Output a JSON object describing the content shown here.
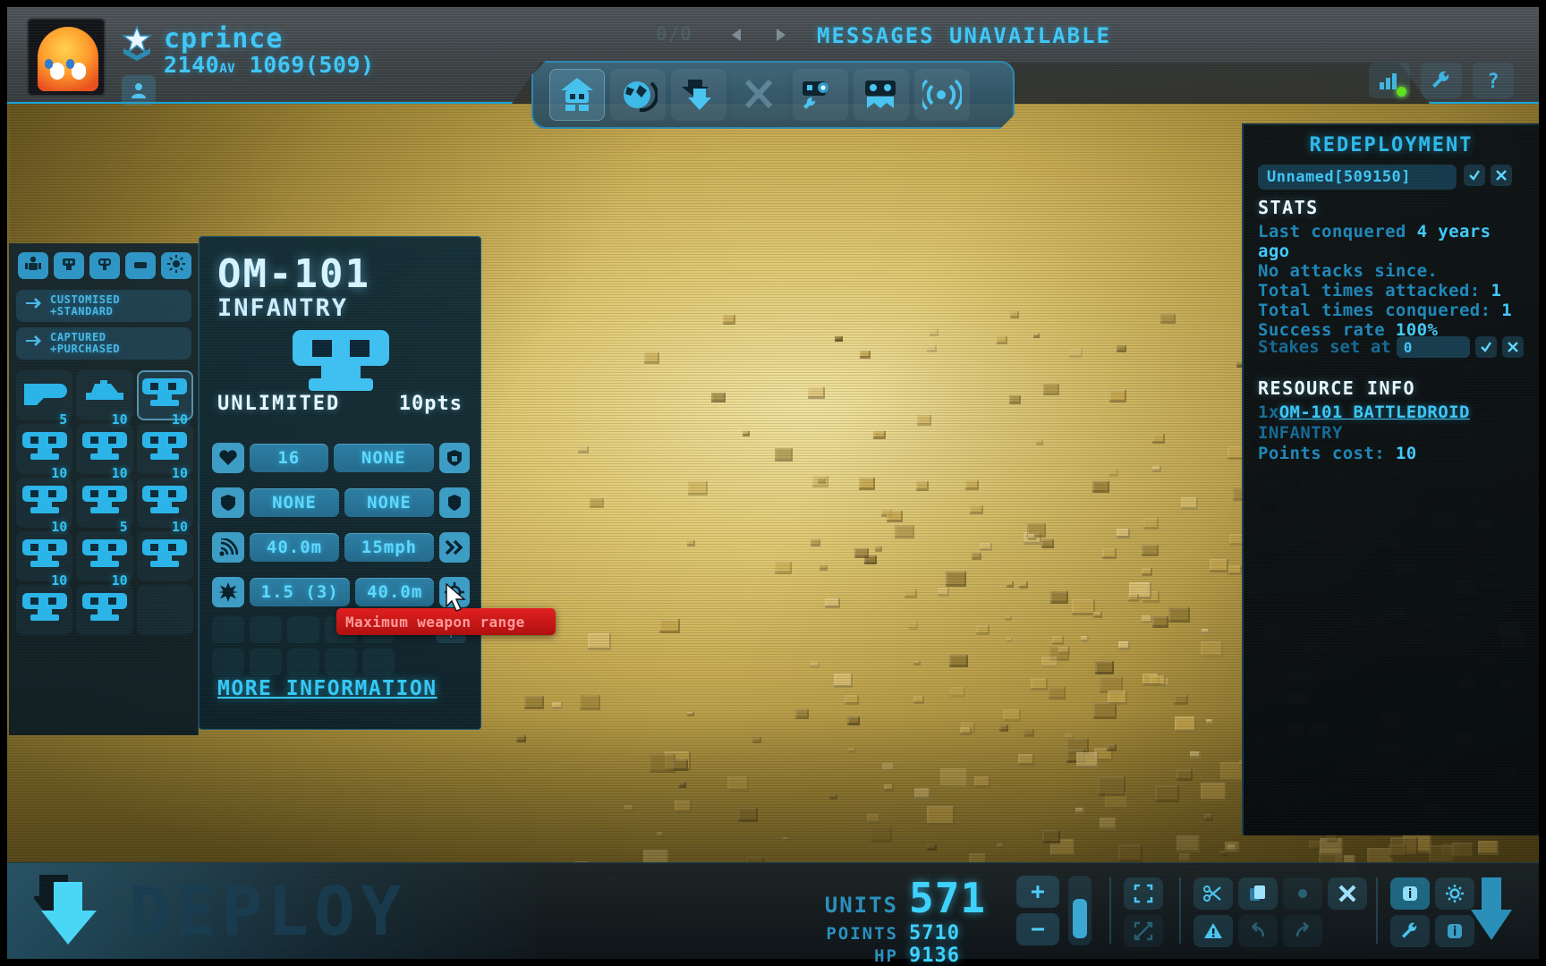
{
  "header": {
    "player_name": "cprince",
    "player_stats_value": "2140",
    "player_stats_suffix": "AV",
    "player_stats_secondary": "1069(509)",
    "rank_icon": "star-chevron-icon",
    "avatar_icon": "ghost-avatar",
    "profile_icon": "person-icon",
    "message_count": "0/0",
    "prev_icon": "triangle-left-icon",
    "next_icon": "triangle-right-icon",
    "messages_status": "MESSAGES UNAVAILABLE",
    "right_icons": [
      {
        "name": "signal-bars-icon",
        "glyph": "bars",
        "status_dot": "#5fdf1c"
      },
      {
        "name": "wrench-icon",
        "glyph": "wrench"
      },
      {
        "name": "help-icon",
        "glyph": "question"
      }
    ]
  },
  "tool_palette": {
    "buttons": [
      {
        "name": "base-icon",
        "glyph": "home-droid",
        "selected": true,
        "dim": false
      },
      {
        "name": "globe-icon",
        "glyph": "globe",
        "selected": false,
        "dim": false
      },
      {
        "name": "deploy-down-icon",
        "glyph": "down-arrows",
        "selected": false,
        "dim": false
      },
      {
        "name": "attack-icon",
        "glyph": "cross-swords",
        "selected": false,
        "dim": true
      },
      {
        "name": "repair-droid-icon",
        "glyph": "droid-wrench",
        "selected": false,
        "dim": false
      },
      {
        "name": "droid-icon",
        "glyph": "droid-head",
        "selected": false,
        "dim": false
      },
      {
        "name": "radio-icon",
        "glyph": "broadcast",
        "selected": false,
        "dim": false
      }
    ]
  },
  "sidebar": {
    "categories": [
      {
        "name": "category-trooper",
        "glyph": "trooper"
      },
      {
        "name": "category-turret",
        "glyph": "turret"
      },
      {
        "name": "category-scout",
        "glyph": "scout"
      },
      {
        "name": "category-structure",
        "glyph": "structure"
      },
      {
        "name": "category-special",
        "glyph": "sun"
      }
    ],
    "filters": [
      {
        "name": "filter-customised-standard",
        "icon": "swap-icon",
        "line1": "CUSTOMISED",
        "line2": "+STANDARD"
      },
      {
        "name": "filter-captured-purchased",
        "icon": "swap-icon",
        "line1": "CAPTURED",
        "line2": "+PURCHASED"
      }
    ],
    "units": [
      {
        "name": "unit-wedge",
        "cost": "",
        "glyph": "wedge",
        "selected": false
      },
      {
        "name": "unit-dome",
        "cost": "",
        "glyph": "dome",
        "selected": false
      },
      {
        "name": "unit-om-101",
        "cost": "",
        "glyph": "droid",
        "selected": true
      },
      {
        "name": "unit-slot-4",
        "cost": "5",
        "glyph": "droid",
        "selected": false
      },
      {
        "name": "unit-slot-5",
        "cost": "10",
        "glyph": "droid",
        "selected": false
      },
      {
        "name": "unit-slot-6",
        "cost": "10",
        "glyph": "droid",
        "selected": false
      },
      {
        "name": "unit-slot-7",
        "cost": "10",
        "glyph": "droid",
        "selected": false
      },
      {
        "name": "unit-slot-8",
        "cost": "10",
        "glyph": "droid",
        "selected": false
      },
      {
        "name": "unit-slot-9",
        "cost": "10",
        "glyph": "droid",
        "selected": false
      },
      {
        "name": "unit-slot-10",
        "cost": "10",
        "glyph": "droid",
        "selected": false
      },
      {
        "name": "unit-slot-11",
        "cost": "5",
        "glyph": "droid",
        "selected": false
      },
      {
        "name": "unit-slot-12",
        "cost": "10",
        "glyph": "droid",
        "selected": false
      },
      {
        "name": "unit-slot-13",
        "cost": "10",
        "glyph": "droid",
        "selected": false
      },
      {
        "name": "unit-slot-14",
        "cost": "10",
        "glyph": "droid",
        "selected": false
      },
      {
        "name": "unit-slot-15",
        "cost": "",
        "glyph": "",
        "selected": false
      }
    ]
  },
  "unit_card": {
    "title": "OM-101",
    "subtitle": "INFANTRY",
    "availability": "UNLIMITED",
    "points": "10pts",
    "more_information": "MORE INFORMATION",
    "stats": [
      {
        "icon": "heart-icon",
        "left_value": "16",
        "right_value": "NONE",
        "end_icon": "shield-lock-icon"
      },
      {
        "icon": "shield-icon",
        "left_value": "NONE",
        "right_value": "NONE",
        "end_icon": "armour-icon"
      },
      {
        "icon": "radar-icon",
        "left_value": "40.0m",
        "right_value": "15mph",
        "end_icon": "double-chevron-icon"
      },
      {
        "icon": "burst-icon",
        "left_value": "1.5 (3)",
        "right_value": "40.0m",
        "end_icon": "crosshair-icon"
      }
    ],
    "currency_icon": "dollar-icon"
  },
  "tooltip": {
    "text": "Maximum weapon range",
    "color": "#e02020"
  },
  "right_panel": {
    "title": "REDEPLOYMENT",
    "name_field_value": "Unnamed[509150]",
    "confirm_icon": "check-icon",
    "cancel_icon": "x-icon",
    "stats_heading": "STATS",
    "stats_lines": [
      {
        "label": "Last conquered ",
        "value": "4 years",
        "tail": " ago"
      },
      {
        "label": "No attacks since.",
        "value": "",
        "tail": ""
      },
      {
        "label": "Total times attacked: ",
        "value": "1",
        "tail": ""
      },
      {
        "label": "Total times conquered: ",
        "value": "1",
        "tail": ""
      },
      {
        "label": "Success rate ",
        "value": "100%",
        "tail": ""
      }
    ],
    "stakes_label": "Stakes set at",
    "stakes_value": "0",
    "resource_heading": "RESOURCE INFO",
    "resource_qty": "1x",
    "resource_name": "OM-101 BATTLEDROID",
    "resource_type": "INFANTRY",
    "resource_points_label": "Points cost: ",
    "resource_points_value": "10"
  },
  "bottom_bar": {
    "deploy_label": "DEPLOY",
    "deploy_icon": "down-arrow-icon",
    "counters": [
      {
        "label": "UNITS",
        "value": "571"
      },
      {
        "label": "POINTS",
        "value": "5710"
      },
      {
        "label": "HP",
        "value": "9136"
      }
    ],
    "plus_label": "+",
    "minus_label": "−",
    "left_tools": [
      {
        "name": "select-all-icon",
        "glyph": "brackets",
        "dim": false
      },
      {
        "name": "deselect-icon",
        "glyph": "slash-box",
        "dim": true
      }
    ],
    "edit_tools": [
      {
        "name": "cut-icon",
        "glyph": "scissors",
        "dim": false
      },
      {
        "name": "warning-icon",
        "glyph": "warning",
        "dim": false
      },
      {
        "name": "copy-icon",
        "glyph": "copy",
        "dim": false
      },
      {
        "name": "undo-icon",
        "glyph": "undo",
        "dim": true
      },
      {
        "name": "paste-icon",
        "glyph": "paste",
        "dim": true
      },
      {
        "name": "redo-icon",
        "glyph": "redo",
        "dim": true
      },
      {
        "name": "delete-icon",
        "glyph": "x",
        "dim": false
      },
      {
        "name": "spacer-icon",
        "glyph": "",
        "dim": true
      }
    ],
    "right_tools": [
      {
        "name": "info-icon",
        "glyph": "info",
        "hl": true
      },
      {
        "name": "settings-icon",
        "glyph": "gear",
        "hl": false
      },
      {
        "name": "tools-icon",
        "glyph": "wrench",
        "hl": false
      },
      {
        "name": "details-icon",
        "glyph": "info-small",
        "hl": false
      }
    ],
    "confirm_icon": "down-arrow-confirm-icon"
  },
  "colors": {
    "accent_cyan": "#3fc6f5",
    "panel_dark": "#0a1014",
    "terrain": "#d6bb63",
    "alert_red": "#e02020",
    "status_green": "#5fdf1c"
  }
}
